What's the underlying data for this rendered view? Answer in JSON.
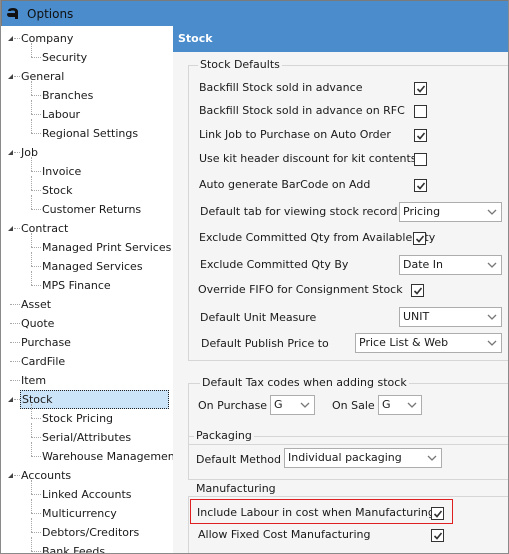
{
  "window": {
    "title": "Options"
  },
  "tree": {
    "items": [
      {
        "label": "Company",
        "level": 0,
        "expanded": true
      },
      {
        "label": "Security",
        "level": 1
      },
      {
        "label": "General",
        "level": 0,
        "expanded": true
      },
      {
        "label": "Branches",
        "level": 1
      },
      {
        "label": "Labour",
        "level": 1
      },
      {
        "label": "Regional Settings",
        "level": 1
      },
      {
        "label": "Job",
        "level": 0,
        "expanded": true
      },
      {
        "label": "Invoice",
        "level": 1
      },
      {
        "label": "Stock",
        "level": 1
      },
      {
        "label": "Customer Returns",
        "level": 1
      },
      {
        "label": "Contract",
        "level": 0,
        "expanded": true
      },
      {
        "label": "Managed Print Services",
        "level": 1
      },
      {
        "label": "Managed Services",
        "level": 1
      },
      {
        "label": "MPS Finance",
        "level": 1
      },
      {
        "label": "Asset",
        "level": 0
      },
      {
        "label": "Quote",
        "level": 0
      },
      {
        "label": "Purchase",
        "level": 0
      },
      {
        "label": "CardFile",
        "level": 0
      },
      {
        "label": "Item",
        "level": 0
      },
      {
        "label": "Stock",
        "level": 0,
        "expanded": true,
        "selected": true
      },
      {
        "label": "Stock Pricing",
        "level": 1
      },
      {
        "label": "Serial/Attributes",
        "level": 1
      },
      {
        "label": "Warehouse Management",
        "level": 1
      },
      {
        "label": "Accounts",
        "level": 0,
        "expanded": true
      },
      {
        "label": "Linked Accounts",
        "level": 1
      },
      {
        "label": "Multicurrency",
        "level": 1
      },
      {
        "label": "Debtors/Creditors",
        "level": 1
      },
      {
        "label": "Bank Feeds",
        "level": 1
      }
    ]
  },
  "content": {
    "header": "Stock",
    "stock_defaults": {
      "legend": "Stock Defaults",
      "backfill_advance": {
        "label": "Backfill Stock sold in advance",
        "checked": true
      },
      "backfill_rfc": {
        "label": "Backfill Stock sold in advance on RFC",
        "checked": false
      },
      "link_job": {
        "label": "Link Job to Purchase on Auto Order",
        "checked": true
      },
      "kit_discount": {
        "label": "Use kit header discount for kit contents",
        "checked": false
      },
      "auto_barcode": {
        "label": "Auto generate BarCode on Add",
        "checked": true
      },
      "default_tab": {
        "label": "Default tab for viewing stock record",
        "value": "Pricing"
      },
      "exclude_committed": {
        "label": "Exclude Committed Qty from Available Qty",
        "checked": true
      },
      "exclude_by": {
        "label": "Exclude Committed Qty By",
        "value": "Date In"
      },
      "override_fifo": {
        "label": "Override FIFO for Consignment Stock",
        "checked": true
      },
      "unit_measure": {
        "label": "Default Unit Measure",
        "value": "UNIT"
      },
      "publish_price": {
        "label": "Default Publish Price to",
        "value": "Price List & Web"
      }
    },
    "tax_codes": {
      "legend": "Default Tax codes when adding stock",
      "on_purchase": {
        "label": "On Purchase",
        "value": "G"
      },
      "on_sale": {
        "label": "On Sale",
        "value": "G"
      }
    },
    "packaging": {
      "legend": "Packaging",
      "default_method": {
        "label": "Default Method",
        "value": "Individual packaging"
      }
    },
    "manufacturing": {
      "legend": "Manufacturing",
      "include_labour": {
        "label": "Include Labour in cost when Manufacturing",
        "checked": true
      },
      "fixed_cost": {
        "label": "Allow Fixed Cost Manufacturing",
        "checked": true
      }
    }
  },
  "colors": {
    "accent": "#4a8ccc",
    "selection": "#cce4f7",
    "highlight": "#e02020"
  }
}
